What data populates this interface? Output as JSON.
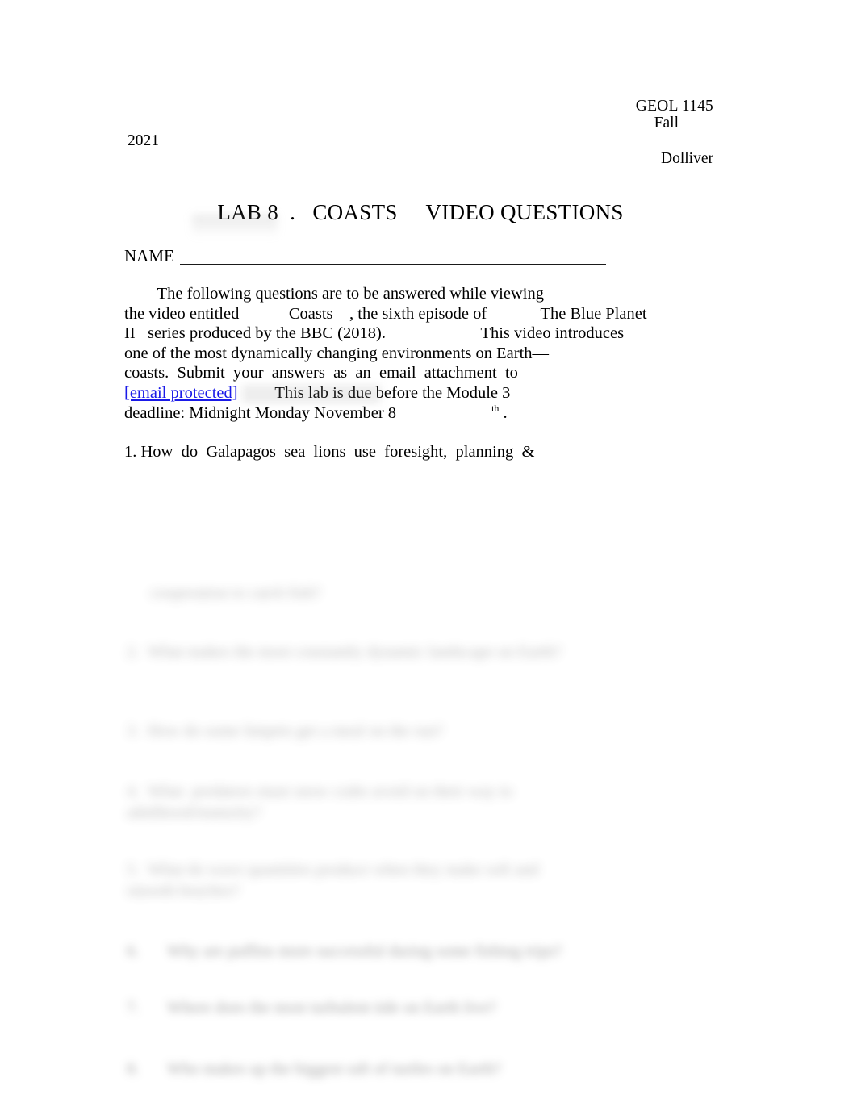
{
  "document": {
    "page_background": "#ffffff",
    "text_color": "#000000",
    "link_color": "#1a1ae8"
  },
  "header": {
    "course": "GEOL 1145",
    "term": "Fall",
    "year": "2021",
    "instructor": "Dolliver"
  },
  "title": {
    "text": "LAB 8  .   COASTS     VIDEO QUESTIONS"
  },
  "name_field": {
    "label": "NAME",
    "value": ""
  },
  "instructions": {
    "line1": "        The following questions are to be answered while viewing",
    "line2": "the video entitled            Coasts    , the sixth episode of             The Blue Planet",
    "line3": "II   series produced by the BBC (2018).                       This video introduces",
    "line4": "one of the most dynamically changing environments on Earth—",
    "line5": "coasts.  Submit  your  answers  as  an  email  attachment  to",
    "email": "[email protected]",
    "line6_after_email": "         This lab is due before the Module 3",
    "line7_prefix": "deadline: Midnight Monday November 8",
    "line7_superscript": "th",
    "line7_suffix": " ."
  },
  "questions": [
    {
      "number": "1.",
      "text": " How  do  Galapagos  sea  lions  use  foresight,  planning  &",
      "redacted": false
    },
    {
      "number": "",
      "text": "cooperation to catch fish?",
      "redacted": true
    },
    {
      "number": "2.",
      "text": "What makes the most constantly dynamic landscape on Earth?",
      "redacted": true
    },
    {
      "number": "3.",
      "text": "How do some limpets get a meal on the run?",
      "redacted": true
    },
    {
      "number": "4.",
      "text": "What  predators must snow crabs avoid on their way to adulthood/maturity?",
      "redacted": true
    },
    {
      "number": "5.",
      "text": "What do wave quantities produce when they make soft and smooth beaches?",
      "redacted": true
    },
    {
      "number": "6.",
      "text": "Why are puffins more successful during some fishing trips?",
      "redacted": true
    },
    {
      "number": "7.",
      "text": "Where does the most turbulent tide on Earth live?",
      "redacted": true
    },
    {
      "number": "8.",
      "text": "Who makes up the biggest raft of turtles on Earth?",
      "redacted": true
    }
  ]
}
